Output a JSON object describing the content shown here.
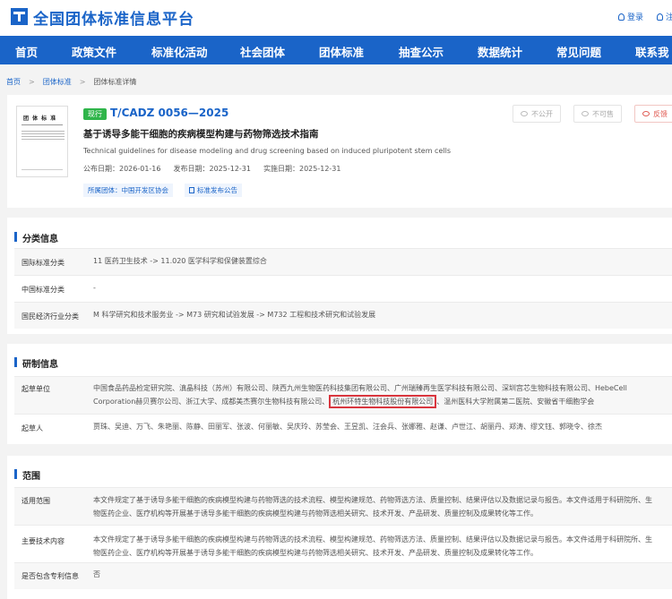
{
  "header": {
    "site_title": "全国团体标准信息平台",
    "login": "登录",
    "register": "注"
  },
  "nav": [
    "首页",
    "政策文件",
    "标准化活动",
    "社会团体",
    "团体标准",
    "抽查公示",
    "数据统计",
    "常见问题",
    "联系我"
  ],
  "breadcrumb": [
    "首页",
    "团体标准",
    "团体标准详情"
  ],
  "standard": {
    "thumb_title": "团 体 标 准",
    "status": "现行",
    "code": "T/CADZ 0056—2025",
    "title": "基于诱导多能干细胞的疾病模型构建与药物筛选技术指南",
    "title_en": "Technical guidelines for disease modeling and drug screening based on induced pluripotent stem cells",
    "dates": [
      "公布日期：2026-01-16",
      "发布日期：2025-12-31",
      "实施日期：2025-12-31"
    ],
    "tags": [
      "所属团体：中国开发区协会",
      "标准发布公告"
    ],
    "actions": [
      "不公开",
      "不可售",
      "反馈"
    ]
  },
  "classification": {
    "title": "分类信息",
    "rows": [
      {
        "label": "国际标准分类",
        "value": "11 医药卫生技术 -> 11.020 医学科学和保健装置综合"
      },
      {
        "label": "中国标准分类",
        "value": "-"
      },
      {
        "label": "国民经济行业分类",
        "value": "M 科学研究和技术服务业 -> M73 研究和试验发展 -> M732 工程和技术研究和试验发展"
      }
    ]
  },
  "development": {
    "title": "研制信息",
    "drafting_units_label": "起草单位",
    "drafting_units_line1": "中国食品药品检定研究院、滇晶科技（苏州）有限公司、陕西九州生物医药科技集团有限公司、广州瑞臻再生医学科技有限公司、深圳宫芯生物科技有限公司、HebeCell",
    "drafting_units_line2a": "Corporation赫贝赛尔公司、浙江大学、成都美杰赛尔生物科技有限公司、",
    "drafting_units_highlight": "杭州环特生物科技股份有限公司",
    "drafting_units_line2b": "、温州医科大学附属第二医院、安徽省干细胞学会",
    "drafters_label": "起草人",
    "drafters": "贾珠、吴迪、万飞、朱艳丽、陈静、田丽军、张波、何丽敏、吴庆玲、苏莹会、王昱凯、汪会兵、张娜雅、赵谦、卢世江、胡丽丹、郑涛、缪文钰、郭晓令、徐杰"
  },
  "scope": {
    "title": "范围",
    "rows": [
      {
        "label": "适用范围",
        "line1": "本文件规定了基于诱导多能干细胞的疾病模型构建与药物筛选的技术流程、模型构建规范、药物筛选方法、质量控制、结果评估以及数据记录与报告。本文件适用于科研院所、生",
        "line2": "物医药企业、医疗机构等开展基于诱导多能干细胞的疾病模型构建与药物筛选相关研究、技术开发、产品研发、质量控制及成果转化等工作。"
      },
      {
        "label": "主要技术内容",
        "line1": "本文件规定了基于诱导多能干细胞的疾病模型构建与药物筛选的技术流程、模型构建规范、药物筛选方法、质量控制、结果评估以及数据记录与报告。本文件适用于科研院所、生",
        "line2": "物医药企业、医疗机构等开展基于诱导多能干细胞的疾病模型构建与药物筛选相关研究、技术开发、产品研发、质量控制及成果转化等工作。"
      },
      {
        "label": "是否包含专利信息",
        "line1": "否",
        "line2": ""
      }
    ]
  }
}
